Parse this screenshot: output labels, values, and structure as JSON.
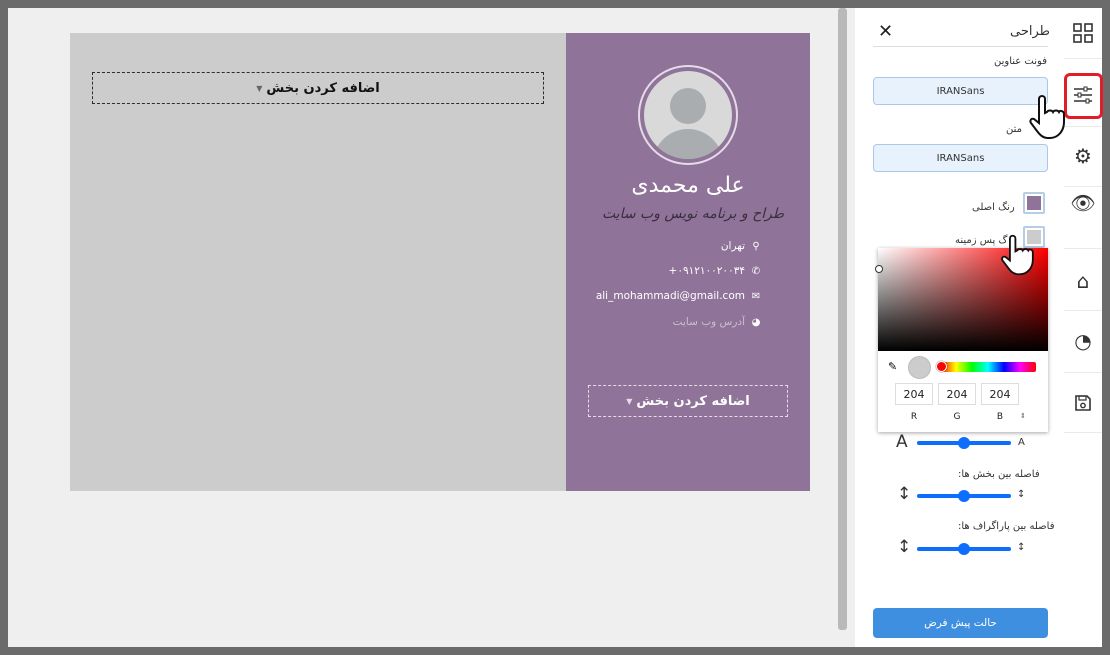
{
  "resume": {
    "name": "علی محمدی",
    "job_title": "طراح و برنامه نویس وب سایت",
    "contacts": [
      {
        "icon": "location-icon",
        "glyph": "⚲",
        "text": "تهران",
        "muted": false
      },
      {
        "icon": "phone-icon",
        "glyph": "✆",
        "text": "۰۹۱۲۱۰۰۲۰۰۳۴+",
        "muted": false
      },
      {
        "icon": "email-icon",
        "glyph": "✉",
        "text": "ali_mohammadi@gmail.com",
        "muted": false
      },
      {
        "icon": "globe-icon",
        "glyph": "◕",
        "text": "آدرس وب سایت",
        "muted": true
      }
    ],
    "add_section_label": "اضافه کردن بخش",
    "colors": {
      "sidebar": "#8f7399",
      "page": "#cccccc"
    }
  },
  "panel": {
    "title": "طراحی",
    "heading_font_label": "فونت عناوین",
    "heading_font_value": "IRANSans",
    "text_font_label": "متن",
    "text_font_value": "IRANSans",
    "main_color_label": "رنگ اصلی",
    "main_color": "#8f7399",
    "bg_color_label": "گ پس زمینه",
    "bg_color": "#cccccc",
    "picker": {
      "r": "204",
      "g": "204",
      "b": "204",
      "r_label": "R",
      "g_label": "G",
      "b_label": "B",
      "arrows": "⌃⌄"
    },
    "font_size_small_label": "A",
    "font_size_large_label": "A",
    "font_size_level": 0.5,
    "section_spacing_label": "فاصله بین بخش ها:",
    "section_spacing_level": 0.5,
    "paragraph_spacing_label": "فاصله بین پاراگراف ها:",
    "paragraph_spacing_level": 0.5,
    "default_button": "حالت پیش فرض"
  },
  "iconbar": [
    "layout-icon",
    "sliders-icon",
    "settings-icon",
    "eye-icon",
    "building-icon",
    "history-icon",
    "save-icon"
  ]
}
